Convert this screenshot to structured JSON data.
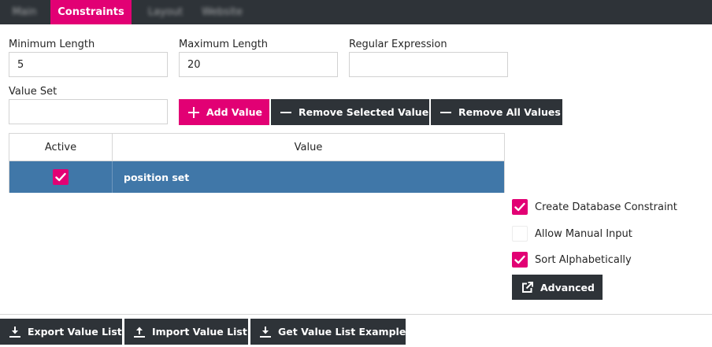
{
  "tabs": [
    {
      "label": "Main",
      "blurred": true
    },
    {
      "label": "Constraints",
      "blurred": false
    },
    {
      "label": "Layout",
      "blurred": true
    },
    {
      "label": "Website",
      "blurred": true
    }
  ],
  "fields": {
    "min_length": {
      "label": "Minimum Length",
      "value": "5"
    },
    "max_length": {
      "label": "Maximum Length",
      "value": "20"
    },
    "regex": {
      "label": "Regular Expression",
      "value": ""
    },
    "value_set": {
      "label": "Value Set",
      "value": ""
    }
  },
  "value_buttons": {
    "add": "Add Value",
    "remove_selected": "Remove Selected Value",
    "remove_all": "Remove All Values"
  },
  "table": {
    "columns": [
      "Active",
      "Value"
    ],
    "rows": [
      {
        "active": true,
        "value": "position set"
      }
    ]
  },
  "options": {
    "create_db_constraint": {
      "label": "Create Database Constraint",
      "checked": true
    },
    "allow_manual_input": {
      "label": "Allow Manual Input",
      "checked": false
    },
    "sort_alphabetically": {
      "label": "Sort Alphabetically",
      "checked": true
    }
  },
  "advanced_button": "Advanced",
  "footer_buttons": {
    "export": "Export Value List",
    "import": "Import Value List",
    "example": "Get Value List Example"
  },
  "colors": {
    "accent": "#e20074",
    "dark": "#2e3338",
    "selected_row": "#4077a8"
  }
}
